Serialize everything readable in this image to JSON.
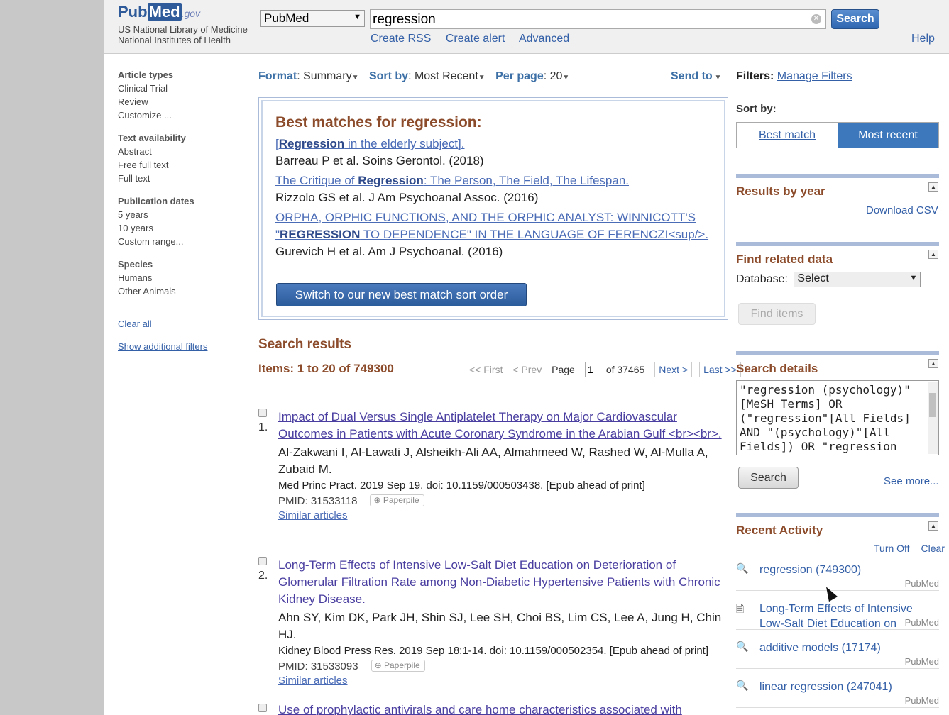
{
  "header": {
    "logo_pub": "Pub",
    "logo_med": "Med",
    "logo_gov": ".gov",
    "nlm_line1": "US National Library of Medicine",
    "nlm_line2": "National Institutes of Health",
    "db_select": "PubMed",
    "search_value": "regression",
    "search_button": "Search",
    "links": [
      "Create RSS",
      "Create alert",
      "Advanced"
    ],
    "help": "Help"
  },
  "leftnav": {
    "groups": [
      {
        "title": "Article types",
        "items": [
          "Clinical Trial",
          "Review",
          "Customize ..."
        ]
      },
      {
        "title": "Text availability",
        "items": [
          "Abstract",
          "Free full text",
          "Full text"
        ]
      },
      {
        "title": "Publication dates",
        "items": [
          "5 years",
          "10 years",
          "Custom range..."
        ]
      },
      {
        "title": "Species",
        "items": [
          "Humans",
          "Other Animals"
        ]
      }
    ],
    "clear_all": "Clear all",
    "show_filters": "Show additional filters"
  },
  "toolbar": {
    "format_label": "Format",
    "format_value": "Summary",
    "sort_label": "Sort by",
    "sort_value": "Most Recent",
    "perpage_label": "Per page",
    "perpage_value": "20",
    "send_to": "Send to"
  },
  "best_matches": {
    "title": "Best matches for regression:",
    "items": [
      {
        "pre": "[",
        "bold": "Regression",
        "post": " in the elderly subject].",
        "cite": "Barreau P et al. Soins Gerontol. (2018)"
      },
      {
        "pre": "The Critique of ",
        "bold": "Regression",
        "post": ": The Person, The Field, The Lifespan.",
        "cite": "Rizzolo GS et al. J Am Psychoanal Assoc. (2016)"
      },
      {
        "pre": "ORPHA, ORPHIC FUNCTIONS, AND THE ORPHIC ANALYST: WINNICOTT'S \"",
        "bold": "REGRESSION",
        "post": " TO DEPENDENCE\" IN THE LANGUAGE OF FERENCZI<sup/>.",
        "cite": "Gurevich H et al. Am J Psychoanal. (2016)"
      }
    ],
    "switch_button": "Switch to our new best match sort order"
  },
  "results": {
    "title": "Search results",
    "items_count": "Items: 1 to 20 of 749300",
    "pager": {
      "first": "<< First",
      "prev": "< Prev",
      "page_label": "Page",
      "page_value": "1",
      "of": "of 37465",
      "next": "Next >",
      "last": "Last >>"
    },
    "items": [
      {
        "num": "1.",
        "title": "Impact of Dual Versus Single Antiplatelet Therapy on Major Cardiovascular Outcomes in Patients with Acute Coronary Syndrome in the Arabian Gulf <br><br>.",
        "authors": "Al-Zakwani I, Al-Lawati J, Alsheikh-Ali AA, Almahmeed W, Rashed W, Al-Mulla A, Zubaid M.",
        "source": "Med Princ Pract. 2019 Sep 19. doi: 10.1159/000503438. [Epub ahead of print]",
        "pmid": "PMID: 31533118",
        "paperpile": "Paperpile",
        "similar": "Similar articles"
      },
      {
        "num": "2.",
        "title": "Long-Term Effects of Intensive Low-Salt Diet Education on Deterioration of Glomerular Filtration Rate among Non-Diabetic Hypertensive Patients with Chronic Kidney Disease.",
        "authors": "Ahn SY, Kim DK, Park JH, Shin SJ, Lee SH, Choi BS, Lim CS, Lee A, Jung H, Chin HJ.",
        "source": "Kidney Blood Press Res. 2019 Sep 18:1-14. doi: 10.1159/000502354. [Epub ahead of print]",
        "pmid": "PMID: 31533093",
        "paperpile": "Paperpile",
        "similar": "Similar articles"
      },
      {
        "num": "",
        "title": "Use of prophylactic antivirals and care home characteristics associated with",
        "authors": "",
        "source": "",
        "pmid": "",
        "paperpile": "",
        "similar": ""
      }
    ]
  },
  "right": {
    "filters_label": "Filters:",
    "manage_filters": "Manage Filters",
    "sort_by": "Sort by:",
    "sort_best": "Best match",
    "sort_recent": "Most recent",
    "results_by_year": "Results by year",
    "download_csv": "Download CSV",
    "find_related": "Find related data",
    "database_label": "Database:",
    "database_select": "Select",
    "find_items": "Find items",
    "search_details": "Search details",
    "details_text": "\"regression (psychology)\"\n[MeSH Terms] OR\n(\"regression\"[All Fields]\nAND \"(psychology)\"[All\nFields]) OR \"regression",
    "search_button": "Search",
    "see_more": "See more...",
    "recent_activity": "Recent Activity",
    "turn_off": "Turn Off",
    "clear": "Clear",
    "activity": [
      {
        "icon": "search",
        "text": "regression (749300)",
        "src": "PubMed"
      },
      {
        "icon": "doc",
        "text": "Long-Term Effects of Intensive Low-Salt Diet Education on",
        "src": "PubMed"
      },
      {
        "icon": "search",
        "text": "additive models (17174)",
        "src": "PubMed"
      },
      {
        "icon": "search",
        "text": "linear regression (247041)",
        "src": "PubMed"
      }
    ]
  },
  "colors": {
    "brand": "#2f5b9a",
    "heading": "#8c4c2b",
    "link": "#3460a8",
    "accent": "#3d78bd"
  }
}
